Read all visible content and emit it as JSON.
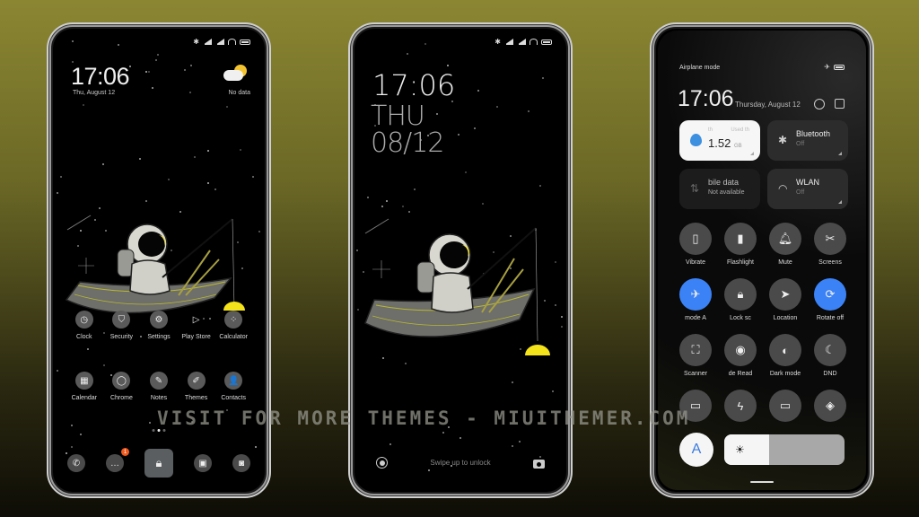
{
  "colors": {
    "accent_blue": "#3b82f6",
    "badge_orange": "#f05a1e",
    "moon_yellow": "#f4e21a",
    "background_top": "#8b8632",
    "background_bottom": "#0e0d06"
  },
  "watermark": "VISIT FOR MORE THEMES - MIUITHEMER.COM",
  "home_screen": {
    "time": "17:06",
    "date": "Thu, August 12",
    "weather": {
      "icon": "partly-cloudy-icon",
      "text": "No data"
    },
    "status_icons": [
      "bluetooth-icon",
      "signal-icon",
      "signal-icon",
      "wifi-icon",
      "battery-icon"
    ],
    "row1": [
      {
        "label": "Clock",
        "icon": "clock-icon"
      },
      {
        "label": "Security",
        "icon": "shield-icon"
      },
      {
        "label": "Settings",
        "icon": "gear-icon"
      },
      {
        "label": "Play Store",
        "icon": "play-store-icon"
      },
      {
        "label": "Calculator",
        "icon": "calculator-icon"
      }
    ],
    "row2": [
      {
        "label": "Calendar",
        "icon": "calendar-icon"
      },
      {
        "label": "Chrome",
        "icon": "chrome-icon"
      },
      {
        "label": "Notes",
        "icon": "notes-icon"
      },
      {
        "label": "Themes",
        "icon": "themes-icon"
      },
      {
        "label": "Contacts",
        "icon": "contacts-icon"
      }
    ],
    "dock": [
      {
        "icon": "phone-icon"
      },
      {
        "icon": "messages-icon",
        "badge": "1"
      },
      {
        "icon": "lock-icon"
      },
      {
        "icon": "gallery-icon"
      },
      {
        "icon": "camera-icon"
      }
    ]
  },
  "lock_screen": {
    "time": "17:06",
    "day": "THU",
    "date": "08/12",
    "hint": "Swipe up to unlock"
  },
  "control_center": {
    "status_label": "Airplane mode",
    "time": "17:06",
    "date": "Thursday, August 12",
    "tiles": [
      {
        "title": "1.52",
        "unit": "GB",
        "sub_left": "th",
        "sub_right": "Used th",
        "icon": "data-usage-icon",
        "state": "white"
      },
      {
        "title": "Bluetooth",
        "sub": "Off",
        "icon": "bluetooth-icon",
        "state": "off"
      },
      {
        "title": "bile data",
        "sub": "Not available",
        "icon": "mobile-data-icon",
        "state": "disabled"
      },
      {
        "title": "WLAN",
        "sub": "Off",
        "icon": "wifi-icon",
        "state": "off"
      }
    ],
    "toggles": [
      {
        "label": "Vibrate",
        "icon": "vibrate-icon",
        "on": false
      },
      {
        "label": "Flashlight",
        "icon": "flashlight-icon",
        "on": false
      },
      {
        "label": "Mute",
        "icon": "bell-icon",
        "on": false
      },
      {
        "label": "Screens",
        "icon": "screenshot-icon",
        "on": false
      },
      {
        "label": "mode   A",
        "icon": "airplane-icon",
        "on": true
      },
      {
        "label": "Lock sc",
        "icon": "lock-icon",
        "on": false
      },
      {
        "label": "Location",
        "icon": "location-icon",
        "on": false
      },
      {
        "label": "Rotate off",
        "icon": "rotate-lock-icon",
        "on": true
      },
      {
        "label": "Scanner",
        "icon": "scanner-icon",
        "on": false
      },
      {
        "label": "de    Read",
        "icon": "eye-icon",
        "on": false
      },
      {
        "label": "Dark mode",
        "icon": "dark-mode-icon",
        "on": false
      },
      {
        "label": "DND",
        "icon": "moon-icon",
        "on": false
      },
      {
        "label": "",
        "icon": "battery-saver-icon",
        "on": false
      },
      {
        "label": "",
        "icon": "lightning-icon",
        "on": false
      },
      {
        "label": "",
        "icon": "cast-icon",
        "on": false
      },
      {
        "label": "",
        "icon": "mi-share-icon",
        "on": false
      }
    ],
    "auto_brightness_label": "A",
    "brightness_level": 0.37
  }
}
